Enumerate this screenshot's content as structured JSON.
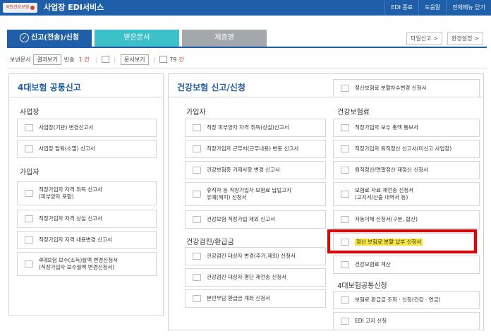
{
  "header": {
    "logo_text": "국민건강보험",
    "app_title": "사업장 EDI서비스",
    "links": [
      "EDI 종료",
      "도움말",
      "전체메뉴 닫기"
    ]
  },
  "tabs": {
    "active": "신고(전송)/신청",
    "received": "받은문서",
    "submitted": "제증명"
  },
  "right_buttons": {
    "file_report": "파일신고 >",
    "settings": "환경설정 >"
  },
  "status": {
    "unread_label": "보낸문서",
    "result_btn": "결과보기",
    "return_label": "반송",
    "return_count": "1 건",
    "doc_btn": "문서보기",
    "doc_count_prefix": "79",
    "doc_count_suffix": "건"
  },
  "left_panel": {
    "title": "4대보험 공통신고",
    "section1": "사업장",
    "s1_items": [
      "사업장(기관) 변경신고서",
      "사업장 탈퇴(소멸) 신고서"
    ],
    "section2": "가입자",
    "s2_items": [
      "직장가입자 자격 취득 신고서\n(피부양자 포함)",
      "직장가입자 자격 상실 신고서",
      "직장가입자 자격 내용변경 신고서",
      "4대보험 보수(소득)월액 변경신청서\n(직장가입자 보수월액 변경신청서)"
    ]
  },
  "right_panel": {
    "title": "건강보험 신고/신청",
    "top_item": "정산보험료 분할차수변경 신청서",
    "col1_section1": "가입자",
    "col1_items1": [
      "직장 피부양자 자격 취득(상실)신고서",
      "직장가입자 근무처(근무내용) 변동 신고서",
      "건강보험증 기재사항 변경 신고서",
      "휴직자 등 직장가입자 보험료 납입고지\n유예(해지) 신청서",
      "건강보험 직장가입 제외 신고서"
    ],
    "col1_section2": "건강검진/환급금",
    "col1_items2": [
      "건강검진 대상자 변경(추가,제외) 신청서",
      "건강검진 대상자 명단 재전송 신청서",
      "본인부담 환급금 계좌 신청서"
    ],
    "col2_section1": "건강보험료",
    "col2_items1": [
      "직장가입자 보수 총액 통보서",
      "직장가입자 퇴직정산 신고서(미신고 사업장)",
      "퇴직정산/연말정산 재정산 신청서",
      "보험료 자료 재전송 신청서\n(고지서/산출 내역서 등)",
      "자동이체 신청서(구분, 합산)",
      "정산 보험료 분할 납부 신청서",
      "건강보험료 계산"
    ],
    "col2_section2": "4대보험공통신청",
    "col2_items2": [
      "보험료 환급금 조회 · 신청(건강 · 연금)",
      "EDI 고지 신청"
    ]
  },
  "colors": {
    "brand_blue": "#1f5ea8",
    "teal_tab": "#3cc1c9",
    "gray_tab": "#a3a8ad",
    "highlight": "#f7e53b",
    "red_box": "#e60000"
  }
}
